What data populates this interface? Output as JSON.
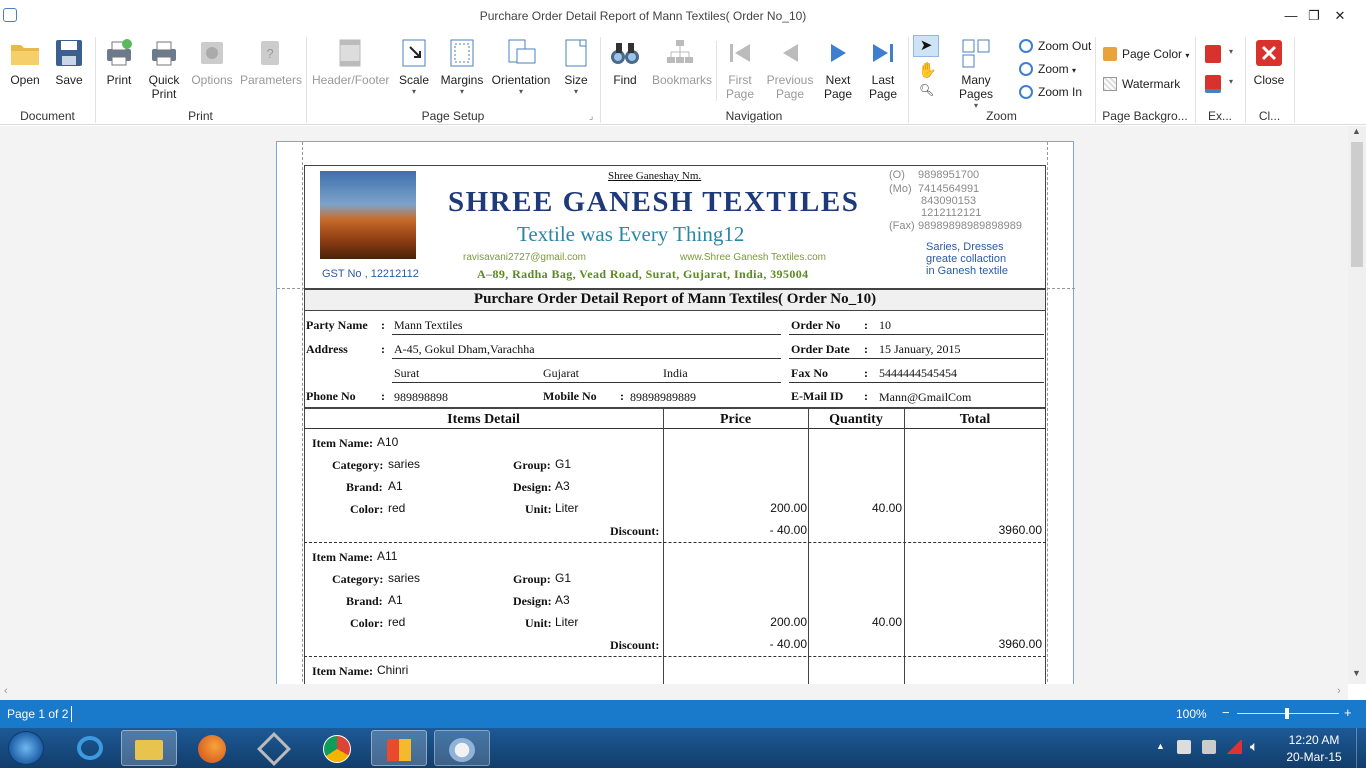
{
  "window": {
    "title": "Purchare Order Detail Report of Mann Textiles( Order No_10)",
    "minimize": "—",
    "restore": "❐",
    "close": "✕"
  },
  "ribbon": {
    "groups": {
      "document": "Document",
      "print": "Print",
      "page_setup": "Page Setup",
      "navigation": "Navigation",
      "zoom": "Zoom",
      "page_background": "Page Backgro...",
      "export": "Ex...",
      "close": "Cl..."
    },
    "buttons": {
      "open": "Open",
      "save": "Save",
      "print": "Print",
      "quick_print_1": "Quick",
      "quick_print_2": "Print",
      "options": "Options",
      "parameters": "Parameters",
      "header_footer": "Header/Footer",
      "scale": "Scale",
      "margins": "Margins",
      "orientation": "Orientation",
      "size": "Size",
      "find": "Find",
      "bookmarks": "Bookmarks",
      "first_page_1": "First",
      "first_page_2": "Page",
      "previous_page_1": "Previous",
      "previous_page_2": "Page",
      "next_page_1": "Next",
      "next_page_2": "Page",
      "last_page_1": "Last",
      "last_page_2": "Page",
      "many_pages": "Many Pages",
      "zoom_out": "Zoom Out",
      "zoom": "Zoom",
      "zoom_in": "Zoom In",
      "page_color": "Page Color",
      "watermark": "Watermark",
      "close": "Close"
    }
  },
  "report": {
    "header": {
      "blessing": "Shree Ganeshay Nm.",
      "company": "SHREE GANESH TEXTILES",
      "tagline": "Textile was Every Thing12",
      "email": "ravisavani2727@gmail.com",
      "website": "www.Shree Ganesh Textiles.com",
      "address": "A–89, Radha Bag, Vead Road, Surat, Gujarat, India, 395004",
      "gst": "GST No , 12212112",
      "phone_o_label": "(O)",
      "phone_o": "9898951700",
      "phone_mo_label": "(Mo)",
      "phone_mo_1": "7414564991",
      "phone_mo_2": "843090153",
      "phone_mo_3": "1212112121",
      "fax_label": "(Fax)",
      "fax": "98989898989898989",
      "slogan_1": "Saries, Dresses",
      "slogan_2": "greate collaction",
      "slogan_3": "in Ganesh textile"
    },
    "title": "Purchare Order Detail Report of Mann Textiles( Order No_10)",
    "party": {
      "party_name_label": "Party Name",
      "party_name": "Mann Textiles",
      "address_label": "Address",
      "address": "A-45, Gokul Dham,Varachha",
      "city": "Surat",
      "state": "Gujarat",
      "country": "India",
      "phone_label": "Phone No",
      "phone": "989898898",
      "mobile_label": "Mobile No",
      "mobile": "89898989889",
      "order_no_label": "Order No",
      "order_no": "10",
      "order_date_label": "Order Date",
      "order_date": "15 January, 2015",
      "fax_label": "Fax No",
      "fax": "5444444545454",
      "email_label": "E-Mail ID",
      "email": "Mann@GmailCom",
      "colon": ":"
    },
    "columns": [
      "Items Detail",
      "Price",
      "Quantity",
      "Total"
    ],
    "field_labels": {
      "item_name": "Item Name:",
      "category": "Category:",
      "group": "Group:",
      "brand": "Brand:",
      "design": "Design:",
      "color": "Color:",
      "unit": "Unit:",
      "discount": "Discount:"
    },
    "items": [
      {
        "name": "A10",
        "category": "saries",
        "group": "G1",
        "brand": "A1",
        "design": "A3",
        "color": "red",
        "unit": "Liter",
        "price": "200.00",
        "quantity": "40.00",
        "discount": "- 40.00",
        "total": "3960.00"
      },
      {
        "name": "A11",
        "category": "saries",
        "group": "G1",
        "brand": "A1",
        "design": "A3",
        "color": "red",
        "unit": "Liter",
        "price": "200.00",
        "quantity": "40.00",
        "discount": "- 40.00",
        "total": "3960.00"
      },
      {
        "name": "Chinri"
      }
    ]
  },
  "status": {
    "page": "Page 1 of 2",
    "zoom": "100%",
    "minus": "−",
    "plus": "+"
  },
  "taskbar": {
    "time": "12:20 AM",
    "date": "20-Mar-15"
  },
  "colors": {
    "accent": "#1979ca",
    "company_title": "#1f3a78",
    "tagline": "#2a86a6",
    "address_green": "#5b8a1e"
  }
}
